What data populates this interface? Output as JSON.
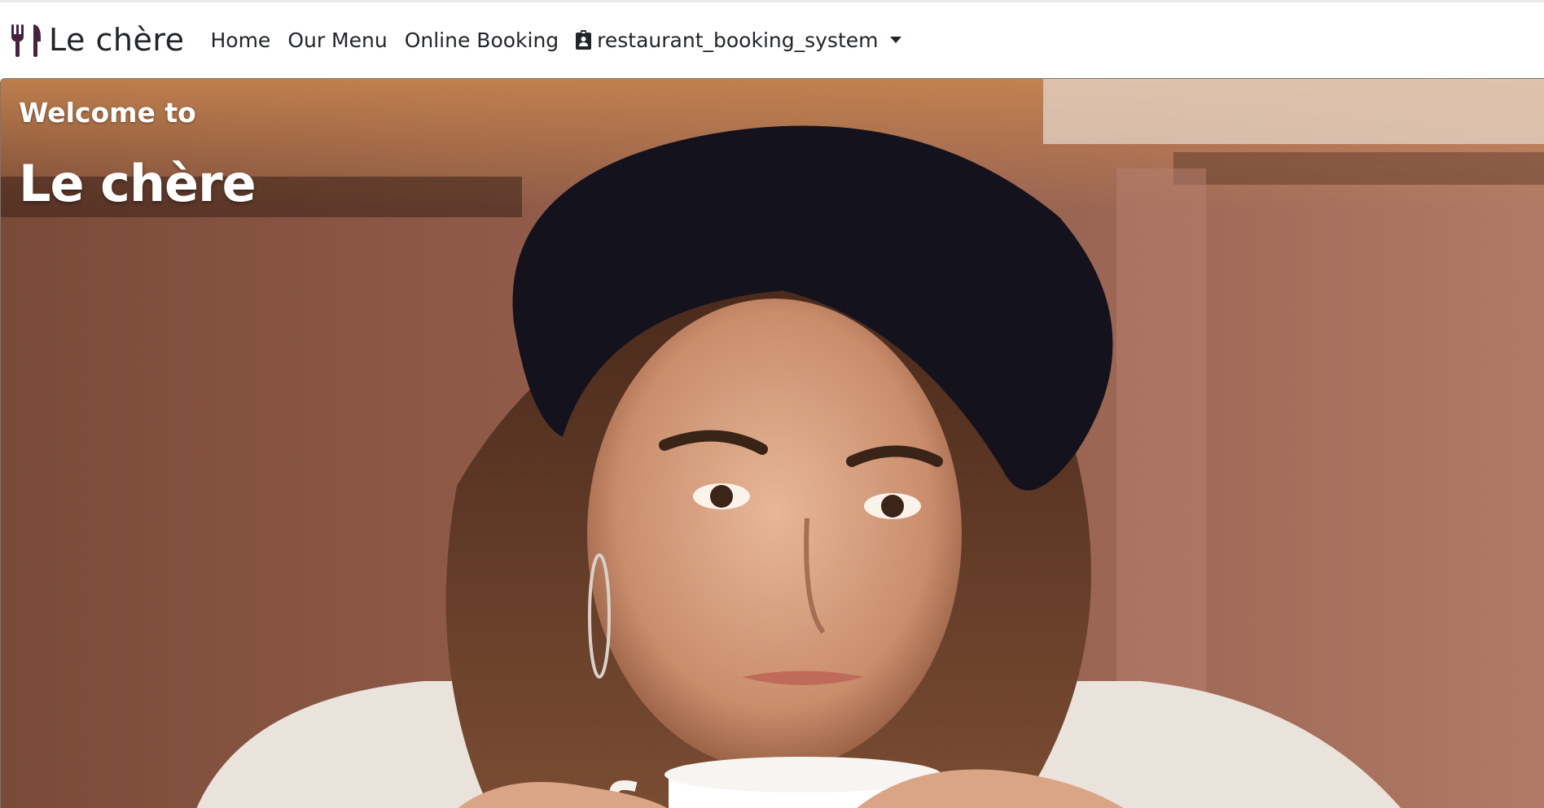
{
  "brand": {
    "name": "Le chère",
    "icon": "utensils-icon",
    "icon_color": "#4a2040"
  },
  "nav": {
    "links": [
      "Home",
      "Our Menu",
      "Online Booking"
    ],
    "dropdown_label": "restaurant_booking_system",
    "dropdown_icon": "id-badge-icon"
  },
  "hero": {
    "subtitle": "Welcome to",
    "title": "Le chère",
    "image": "woman-in-beret-drinking-coffee-photo"
  }
}
